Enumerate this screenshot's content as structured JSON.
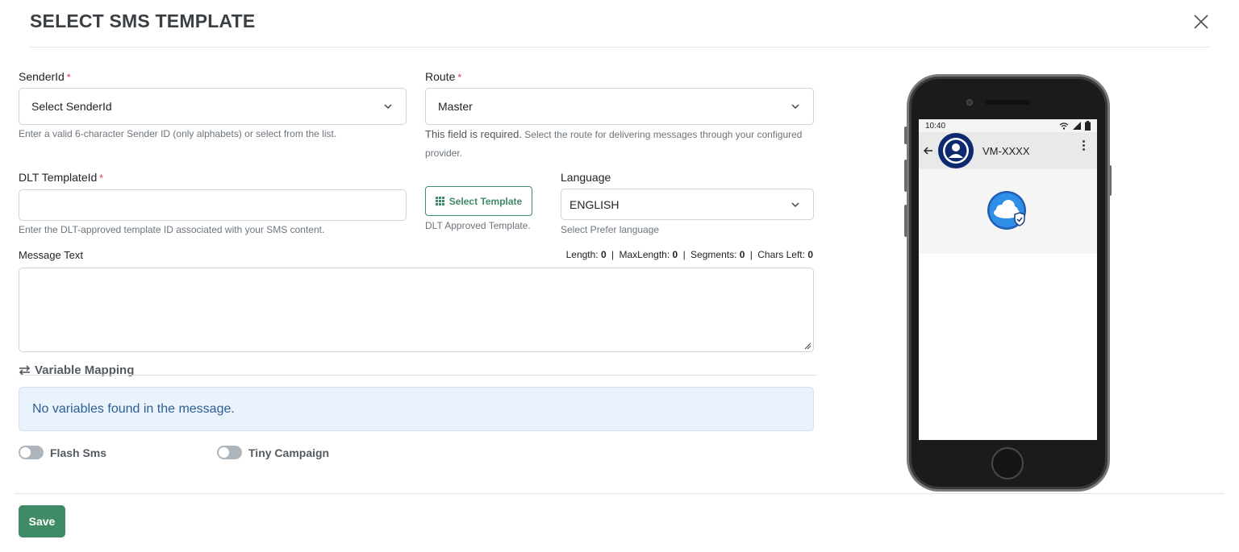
{
  "modal": {
    "title": "SELECT SMS TEMPLATE",
    "close_icon": "close-icon"
  },
  "sender": {
    "label": "SenderId",
    "required": "*",
    "selected": "Select SenderId",
    "help": "Enter a valid 6-character Sender ID (only alphabets) or select from the list."
  },
  "route": {
    "label": "Route",
    "required": "*",
    "selected": "Master",
    "error": "This field is required.",
    "help": " Select the route for delivering messages through your configured",
    "help_line2": "provider."
  },
  "dlt": {
    "label": "DLT TemplateId",
    "required": "*",
    "value": "",
    "help": "Enter the DLT-approved template ID associated with your SMS content."
  },
  "template_button": {
    "label": "Select Template",
    "help": "DLT Approved Template."
  },
  "language": {
    "label": "Language",
    "selected": "ENGLISH",
    "help": "Select Prefer language"
  },
  "message": {
    "label": "Message Text",
    "value": "",
    "counter": {
      "length_label": "Length:",
      "length": "0",
      "max_label": "MaxLength:",
      "max": "0",
      "segments_label": "Segments:",
      "segments": "0",
      "chars_left_label": "Chars Left:",
      "chars_left": "0",
      "separator": "|"
    }
  },
  "variable_mapping": {
    "title": "Variable Mapping",
    "empty_message": "No variables found in the message."
  },
  "toggles": {
    "flash_sms": {
      "label": "Flash Sms",
      "on": false
    },
    "tiny_campaign": {
      "label": "Tiny Campaign",
      "on": false
    }
  },
  "footer": {
    "save_label": "Save"
  },
  "phone_preview": {
    "time": "10:40",
    "sender_name": "VM-XXXX"
  },
  "colors": {
    "primary_green": "#3f8a67",
    "alert_bg": "#eaf2fb",
    "alert_text": "#2c5f93",
    "required": "#dc3545"
  }
}
